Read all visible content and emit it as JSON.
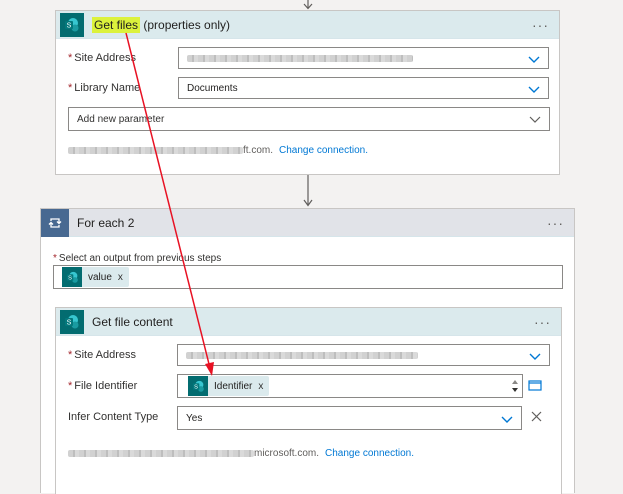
{
  "card1": {
    "title_highlight": "Get files",
    "title_rest": " (properties only)",
    "menu": "···",
    "site_label": "Site Address",
    "library_label": "Library Name",
    "library_value": "Documents",
    "add_param_placeholder": "Add new parameter",
    "connection_suffix": "ft.com.",
    "change_connection": "Change connection."
  },
  "loop": {
    "title": "For each 2",
    "menu": "···",
    "select_label": "Select an output from previous steps",
    "token_value": "value",
    "token_remove": "x"
  },
  "card2": {
    "title": "Get file content",
    "menu": "···",
    "site_label": "Site Address",
    "file_id_label": "File Identifier",
    "file_id_token": "Identifier",
    "token_remove": "x",
    "infer_label": "Infer Content Type",
    "infer_value": "Yes",
    "connection_suffix": "microsoft.com.",
    "change_connection": "Change connection."
  },
  "colors": {
    "sharepoint": "#036c70",
    "loop": "#486991",
    "link": "#0078d4",
    "highlight": "#dcf23c",
    "annotation_arrow": "#e81123"
  },
  "icons": [
    "sharepoint-icon",
    "loop-icon",
    "chevron-down-icon",
    "close-icon",
    "folder-icon",
    "scroll-arrows-icon"
  ]
}
